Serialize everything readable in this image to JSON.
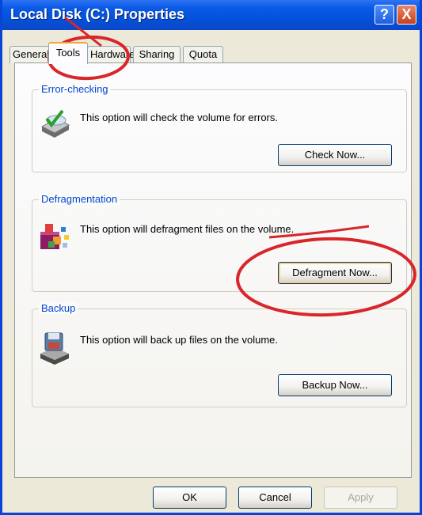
{
  "window": {
    "title": "Local Disk (C:) Properties",
    "help_label": "?",
    "close_label": "X"
  },
  "tabs": [
    {
      "label": "General",
      "active": false
    },
    {
      "label": "Tools",
      "active": true
    },
    {
      "label": "Hardware",
      "active": false
    },
    {
      "label": "Sharing",
      "active": false
    },
    {
      "label": "Quota",
      "active": false
    }
  ],
  "groups": {
    "error_checking": {
      "legend": "Error-checking",
      "description": "This option will check the volume for errors.",
      "button": "Check Now...",
      "icon": "check-disk-icon"
    },
    "defragmentation": {
      "legend": "Defragmentation",
      "description": "This option will defragment files on the volume.",
      "button": "Defragment Now...",
      "icon": "defragment-icon"
    },
    "backup": {
      "legend": "Backup",
      "description": "This option will back up files on the volume.",
      "button": "Backup Now...",
      "icon": "backup-icon"
    }
  },
  "footer": {
    "ok": "OK",
    "cancel": "Cancel",
    "apply": "Apply",
    "apply_enabled": false
  },
  "colors": {
    "titlebar": "#0552db",
    "annotation": "#d8262a",
    "legend_text": "#0046d5"
  }
}
